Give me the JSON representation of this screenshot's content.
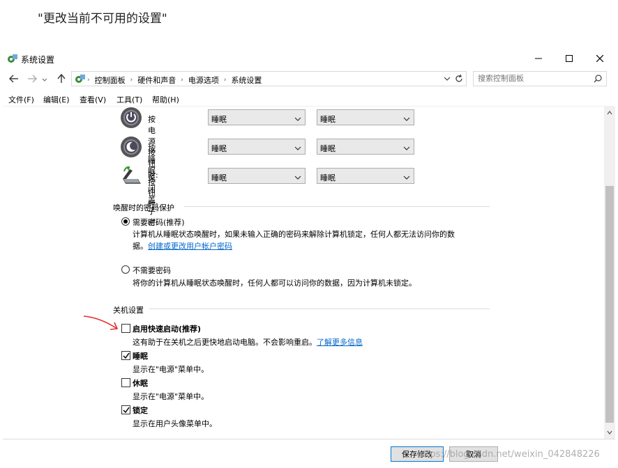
{
  "caption": "\"更改当前不可用的设置\"",
  "window": {
    "title": "系统设置",
    "controls": [
      "minimize-icon",
      "maximize-icon",
      "close-icon"
    ]
  },
  "address": {
    "crumbs": [
      "控制面板",
      "硬件和声音",
      "电源选项",
      "系统设置"
    ],
    "search_placeholder": "搜索控制面板"
  },
  "menu": [
    "文件(F)",
    "编辑(E)",
    "查看(V)",
    "工具(T)",
    "帮助(H)"
  ],
  "power_rows": [
    {
      "label": "按电源按钮时:",
      "battery": "睡眠",
      "plugged": "睡眠",
      "icon": "power-button-icon"
    },
    {
      "label": "按睡眠按钮时:",
      "battery": "睡眠",
      "plugged": "睡眠",
      "icon": "sleep-button-icon"
    },
    {
      "label": "关闭盖子时:",
      "battery": "睡眠",
      "plugged": "睡眠",
      "icon": "laptop-lid-icon"
    }
  ],
  "password": {
    "section_title": "唤醒时的密码保护",
    "require": {
      "label": "需要密码(推荐)",
      "desc_line1": "计算机从睡眠状态唤醒时，如果未输入正确的密码来解除计算机锁定，任何人都无法访问你的数",
      "desc_line2_prefix": "据。",
      "link": "创建或更改用户帐户密码",
      "selected": true
    },
    "norequire": {
      "label": "不需要密码",
      "desc": "将你的计算机从睡眠状态唤醒时，任何人都可以访问你的数据，因为计算机未锁定。",
      "selected": false
    }
  },
  "shutdown": {
    "section_title": "关机设置",
    "options": [
      {
        "label": "启用快速启动(推荐)",
        "desc": "这有助于在关机之后更快地启动电脑。不会影响重启。",
        "link": "了解更多信息",
        "checked": false
      },
      {
        "label": "睡眠",
        "desc": "显示在\"电源\"菜单中。",
        "link": "",
        "checked": true
      },
      {
        "label": "休眠",
        "desc": "显示在\"电源\"菜单中。",
        "link": "",
        "checked": false
      },
      {
        "label": "锁定",
        "desc": "显示在用户头像菜单中。",
        "link": "",
        "checked": true
      }
    ]
  },
  "footer": {
    "save": "保存修改",
    "cancel": "取消"
  },
  "watermark": "https://blog.csdn.net/weixin_042848226",
  "colors": {
    "link": "#0066cc",
    "annotation": "#e53030",
    "focus": "#0078d7"
  }
}
